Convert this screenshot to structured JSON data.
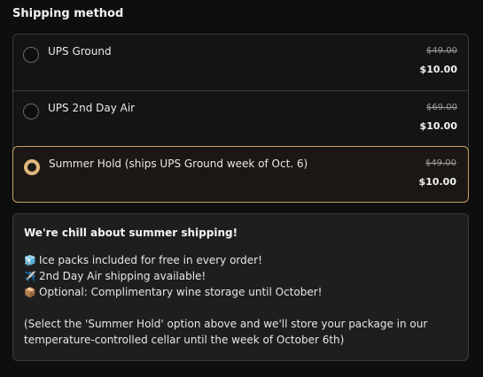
{
  "section_title": "Shipping method",
  "options": [
    {
      "label": "UPS Ground",
      "old_price": "$49.00",
      "price": "$10.00",
      "selected": false
    },
    {
      "label": "UPS 2nd Day Air",
      "old_price": "$69.00",
      "price": "$10.00",
      "selected": false
    },
    {
      "label": "Summer Hold (ships UPS Ground week of Oct. 6)",
      "old_price": "$49.00",
      "price": "$10.00",
      "selected": true
    }
  ],
  "colors": {
    "accent": "#e0b67a",
    "border": "#3b3b3b",
    "selected_border": "#c7a266"
  },
  "notice": {
    "title": "We're chill about summer shipping!",
    "lines": [
      {
        "icon": "🧊",
        "icon_name": "ice-cube-icon",
        "text": "Ice packs included for free in every order!"
      },
      {
        "icon": "✈️",
        "icon_name": "airplane-icon",
        "text": "2nd Day Air shipping available!"
      },
      {
        "icon": "📦",
        "icon_name": "package-icon",
        "text": "Optional: Complimentary wine storage until October!"
      }
    ],
    "footer": "(Select the 'Summer Hold' option above and we'll store your package in our temperature-controlled cellar until the week of October 6th)"
  }
}
